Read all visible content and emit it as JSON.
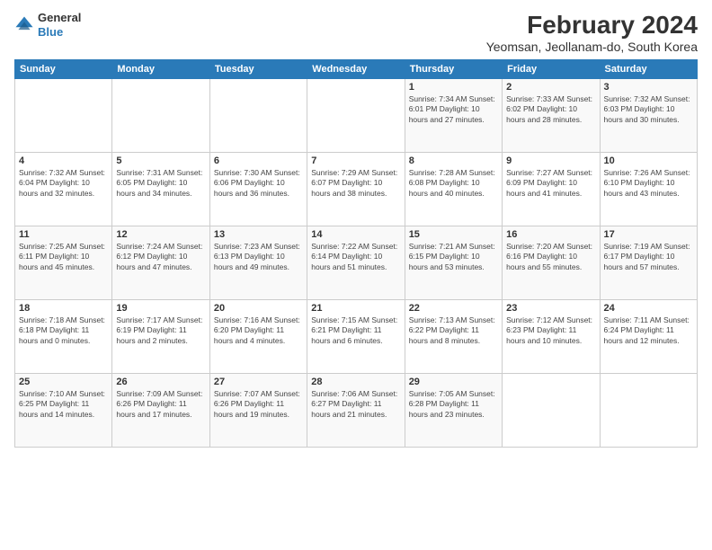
{
  "header": {
    "logo_general": "General",
    "logo_blue": "Blue",
    "title": "February 2024",
    "subtitle": "Yeomsan, Jeollanam-do, South Korea"
  },
  "weekdays": [
    "Sunday",
    "Monday",
    "Tuesday",
    "Wednesday",
    "Thursday",
    "Friday",
    "Saturday"
  ],
  "weeks": [
    [
      {
        "day": "",
        "info": ""
      },
      {
        "day": "",
        "info": ""
      },
      {
        "day": "",
        "info": ""
      },
      {
        "day": "",
        "info": ""
      },
      {
        "day": "1",
        "info": "Sunrise: 7:34 AM\nSunset: 6:01 PM\nDaylight: 10 hours\nand 27 minutes."
      },
      {
        "day": "2",
        "info": "Sunrise: 7:33 AM\nSunset: 6:02 PM\nDaylight: 10 hours\nand 28 minutes."
      },
      {
        "day": "3",
        "info": "Sunrise: 7:32 AM\nSunset: 6:03 PM\nDaylight: 10 hours\nand 30 minutes."
      }
    ],
    [
      {
        "day": "4",
        "info": "Sunrise: 7:32 AM\nSunset: 6:04 PM\nDaylight: 10 hours\nand 32 minutes."
      },
      {
        "day": "5",
        "info": "Sunrise: 7:31 AM\nSunset: 6:05 PM\nDaylight: 10 hours\nand 34 minutes."
      },
      {
        "day": "6",
        "info": "Sunrise: 7:30 AM\nSunset: 6:06 PM\nDaylight: 10 hours\nand 36 minutes."
      },
      {
        "day": "7",
        "info": "Sunrise: 7:29 AM\nSunset: 6:07 PM\nDaylight: 10 hours\nand 38 minutes."
      },
      {
        "day": "8",
        "info": "Sunrise: 7:28 AM\nSunset: 6:08 PM\nDaylight: 10 hours\nand 40 minutes."
      },
      {
        "day": "9",
        "info": "Sunrise: 7:27 AM\nSunset: 6:09 PM\nDaylight: 10 hours\nand 41 minutes."
      },
      {
        "day": "10",
        "info": "Sunrise: 7:26 AM\nSunset: 6:10 PM\nDaylight: 10 hours\nand 43 minutes."
      }
    ],
    [
      {
        "day": "11",
        "info": "Sunrise: 7:25 AM\nSunset: 6:11 PM\nDaylight: 10 hours\nand 45 minutes."
      },
      {
        "day": "12",
        "info": "Sunrise: 7:24 AM\nSunset: 6:12 PM\nDaylight: 10 hours\nand 47 minutes."
      },
      {
        "day": "13",
        "info": "Sunrise: 7:23 AM\nSunset: 6:13 PM\nDaylight: 10 hours\nand 49 minutes."
      },
      {
        "day": "14",
        "info": "Sunrise: 7:22 AM\nSunset: 6:14 PM\nDaylight: 10 hours\nand 51 minutes."
      },
      {
        "day": "15",
        "info": "Sunrise: 7:21 AM\nSunset: 6:15 PM\nDaylight: 10 hours\nand 53 minutes."
      },
      {
        "day": "16",
        "info": "Sunrise: 7:20 AM\nSunset: 6:16 PM\nDaylight: 10 hours\nand 55 minutes."
      },
      {
        "day": "17",
        "info": "Sunrise: 7:19 AM\nSunset: 6:17 PM\nDaylight: 10 hours\nand 57 minutes."
      }
    ],
    [
      {
        "day": "18",
        "info": "Sunrise: 7:18 AM\nSunset: 6:18 PM\nDaylight: 11 hours\nand 0 minutes."
      },
      {
        "day": "19",
        "info": "Sunrise: 7:17 AM\nSunset: 6:19 PM\nDaylight: 11 hours\nand 2 minutes."
      },
      {
        "day": "20",
        "info": "Sunrise: 7:16 AM\nSunset: 6:20 PM\nDaylight: 11 hours\nand 4 minutes."
      },
      {
        "day": "21",
        "info": "Sunrise: 7:15 AM\nSunset: 6:21 PM\nDaylight: 11 hours\nand 6 minutes."
      },
      {
        "day": "22",
        "info": "Sunrise: 7:13 AM\nSunset: 6:22 PM\nDaylight: 11 hours\nand 8 minutes."
      },
      {
        "day": "23",
        "info": "Sunrise: 7:12 AM\nSunset: 6:23 PM\nDaylight: 11 hours\nand 10 minutes."
      },
      {
        "day": "24",
        "info": "Sunrise: 7:11 AM\nSunset: 6:24 PM\nDaylight: 11 hours\nand 12 minutes."
      }
    ],
    [
      {
        "day": "25",
        "info": "Sunrise: 7:10 AM\nSunset: 6:25 PM\nDaylight: 11 hours\nand 14 minutes."
      },
      {
        "day": "26",
        "info": "Sunrise: 7:09 AM\nSunset: 6:26 PM\nDaylight: 11 hours\nand 17 minutes."
      },
      {
        "day": "27",
        "info": "Sunrise: 7:07 AM\nSunset: 6:26 PM\nDaylight: 11 hours\nand 19 minutes."
      },
      {
        "day": "28",
        "info": "Sunrise: 7:06 AM\nSunset: 6:27 PM\nDaylight: 11 hours\nand 21 minutes."
      },
      {
        "day": "29",
        "info": "Sunrise: 7:05 AM\nSunset: 6:28 PM\nDaylight: 11 hours\nand 23 minutes."
      },
      {
        "day": "",
        "info": ""
      },
      {
        "day": "",
        "info": ""
      }
    ]
  ]
}
